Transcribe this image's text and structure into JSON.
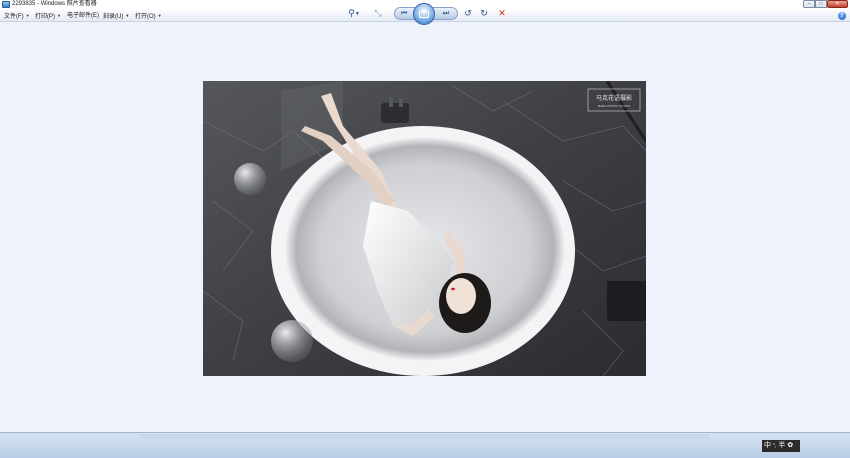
{
  "window": {
    "title": "2293835 - Windows 照片查看器",
    "min_glyph": "–",
    "max_glyph": "□",
    "close_glyph": "✕"
  },
  "menu": {
    "items": [
      {
        "label": "文件(F)"
      },
      {
        "label": "打印(P)"
      },
      {
        "label": "电子邮件(E)"
      },
      {
        "label": "刻录(U)"
      },
      {
        "label": "打开(O)"
      }
    ],
    "help": "?"
  },
  "photo": {
    "watermark_line1": "马克花语摄影",
    "watermark_line2": "MARK PHOTO STUDIO"
  },
  "toolbar": {
    "zoom_glyph": "⚲",
    "fit_glyph": "⤡",
    "prev_glyph": "⏮",
    "next_glyph": "⏭",
    "rotate_ccw_glyph": "↺",
    "rotate_cw_glyph": "↻",
    "delete_glyph": "✕"
  },
  "ime": {
    "lang": "中",
    "punct": "°,",
    "mode": "半",
    "icon": "✿"
  },
  "colors": {
    "viewer_bg": "#eef2fa",
    "toolbar_bg": "#c6d6ec",
    "delete_red": "#d02a1c"
  }
}
